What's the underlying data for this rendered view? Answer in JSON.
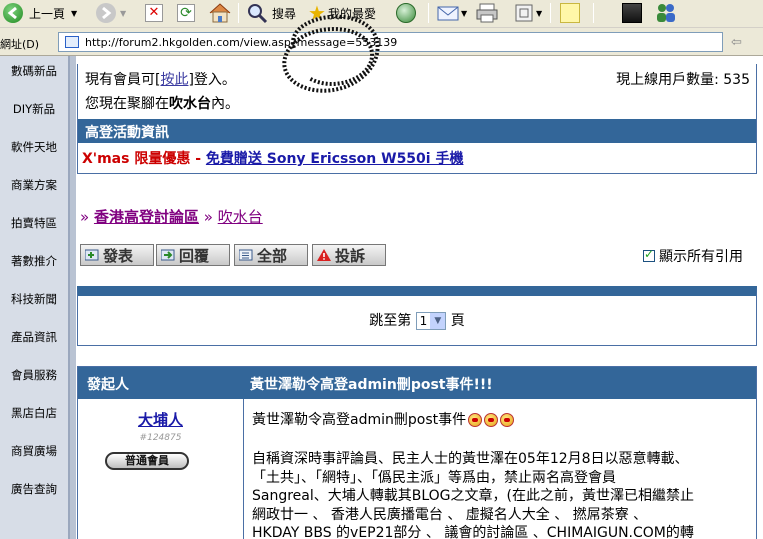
{
  "toolbar": {
    "back_label": "上一頁",
    "search_label": "搜尋",
    "favorites_label": "我的最愛"
  },
  "address": {
    "label": "網址(D)",
    "url": "http://forum2.hkgolden.com/view.asp?message=553139"
  },
  "leftnav": {
    "items": [
      "數碼新品",
      "DIY新品",
      "軟件天地",
      "商業方案",
      "拍賣特區",
      "著數推介",
      "科技新聞",
      "產品資訊",
      "會員服務",
      "黑店白店",
      "商貿廣場",
      "廣告查詢"
    ]
  },
  "info": {
    "member_prefix": "現有會員可[",
    "member_link": "按此",
    "member_suffix": "]登入。",
    "online_label": "現上線用戶數量:",
    "online_count": "535",
    "location_prefix": "您現在聚腳在",
    "location_name": "吹水台",
    "location_suffix": "內。",
    "events_header": "高登活動資訊",
    "promo_red": "X'mas 限量優惠 - ",
    "promo_link": "免費贈送 Sony Ericsson W550i 手機"
  },
  "breadcrumb": {
    "home": "香港高登討論區",
    "current": "吹水台"
  },
  "actions": {
    "post": "發表",
    "reply": "回覆",
    "all": "全部",
    "report": "投訴"
  },
  "quote_toggle": {
    "label": "顯示所有引用",
    "checked": true
  },
  "pager": {
    "prefix": "跳至第",
    "page": "1",
    "suffix": "頁"
  },
  "post": {
    "author_header": "發起人",
    "title_header": "黃世澤勒令高登admin刪post事件!!!",
    "author_name": "大埔人",
    "author_id": "#124875",
    "author_rank": "普通會員",
    "subject": "黃世澤勒令高登admin刪post事件",
    "body_lines": [
      "自稱資深時事評論員、民主人士的黃世澤在05年12月8日以惡意轉載、",
      "「土共」、「網特」、「僞民主派」等爲由，禁止兩名高登會員",
      "Sangreal、大埔人轉載其BLOG之文章，(在此之前，黃世澤已相繼禁止",
      "網政廿一 、 香港人民廣播電台 、 虛擬名人大全 、 撚屌茶寮 、",
      "HKDAY BBS 的vEP21部分 、 議會的討論區 、CHIMAIGUN.COM的轉"
    ]
  },
  "colors": {
    "header_blue": "#336699",
    "nav_bg": "#d7dde7",
    "link_purple": "#800080"
  }
}
